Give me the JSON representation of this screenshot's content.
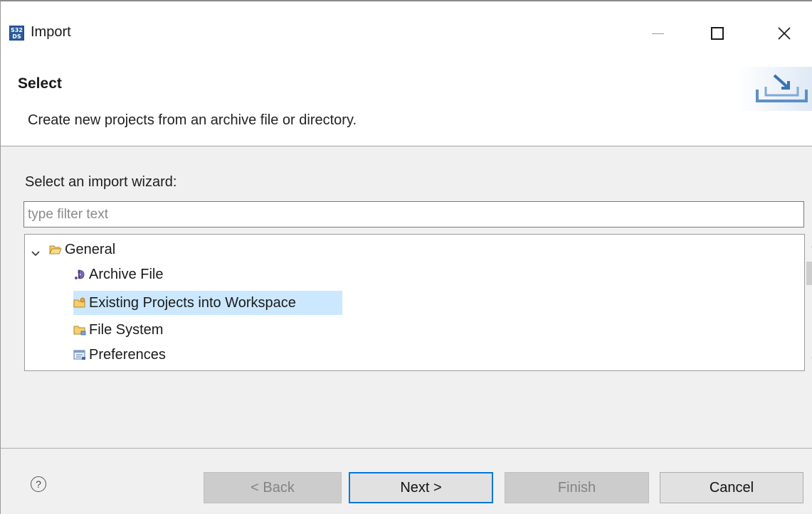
{
  "window": {
    "title": "Import",
    "app_icon_text_top": "S32",
    "app_icon_text_bottom": "DS"
  },
  "header": {
    "title": "Select",
    "description": "Create new projects from an archive file or directory."
  },
  "body": {
    "prompt": "Select an import wizard:",
    "filter": {
      "placeholder": "type filter text",
      "value": ""
    },
    "tree": [
      {
        "label": "General",
        "icon": "folder-open-icon",
        "expanded": true,
        "selected": false
      },
      {
        "label": "Archive File",
        "icon": "archive-icon",
        "selected": false
      },
      {
        "label": "Existing Projects into Workspace",
        "icon": "project-folder-icon",
        "selected": true
      },
      {
        "label": "File System",
        "icon": "folder-icon",
        "selected": false
      },
      {
        "label": "Preferences",
        "icon": "preferences-icon",
        "selected": false
      }
    ]
  },
  "footer": {
    "help_symbol": "?",
    "back": "< Back",
    "next": "Next >",
    "finish": "Finish",
    "cancel": "Cancel"
  },
  "colors": {
    "selection": "#cce8ff",
    "default_button_border": "#0078d7",
    "folder": "#e8b84a"
  }
}
